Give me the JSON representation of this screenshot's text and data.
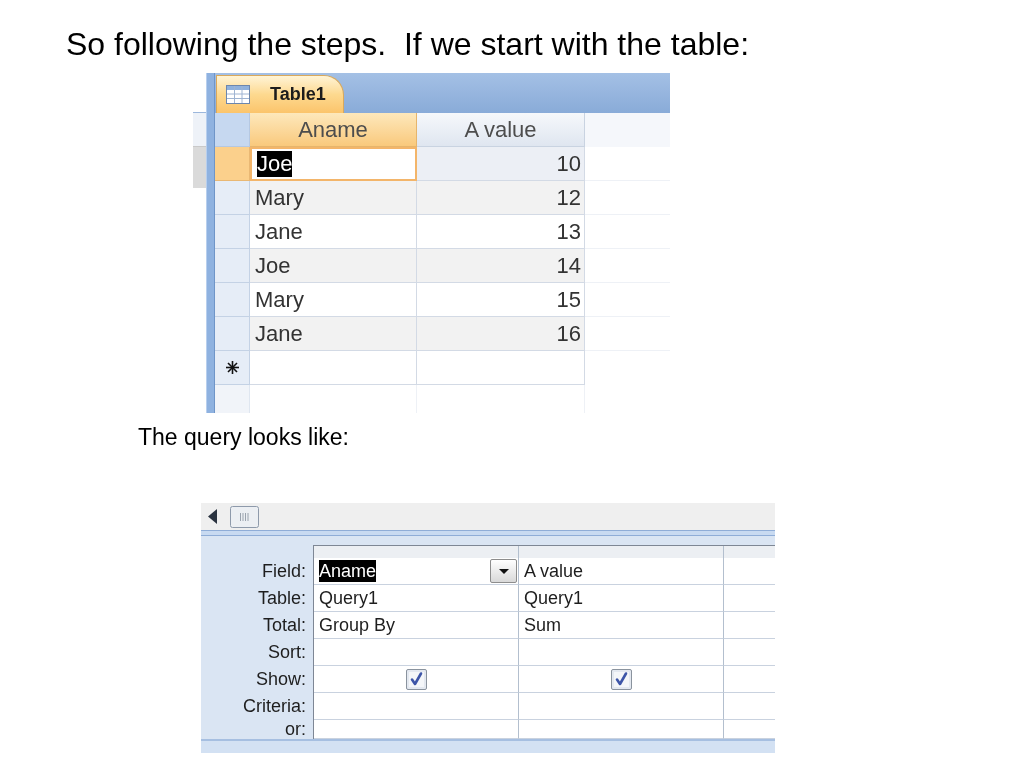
{
  "heading": "So following the steps.  If we start with the table:",
  "table_window": {
    "tab": {
      "label": "Table1",
      "selected": true
    },
    "columns": [
      {
        "label": "Aname",
        "kind": "text",
        "selected": true
      },
      {
        "label": "A value",
        "kind": "number",
        "selected": false
      }
    ],
    "rows": [
      {
        "selected": true,
        "cells": [
          "Joe",
          "10"
        ]
      },
      {
        "selected": false,
        "cells": [
          "Mary",
          "12"
        ]
      },
      {
        "selected": false,
        "cells": [
          "Jane",
          "13"
        ]
      },
      {
        "selected": false,
        "cells": [
          "Joe",
          "14"
        ]
      },
      {
        "selected": false,
        "cells": [
          "Mary",
          "15"
        ]
      },
      {
        "selected": false,
        "cells": [
          "Jane",
          "16"
        ]
      }
    ]
  },
  "caption": "The query looks like:",
  "query_grid": {
    "rows": [
      {
        "label": "Field:",
        "kind": "text",
        "cells": [
          {
            "text": "Aname",
            "selected": true
          },
          {
            "text": "A value",
            "selected": false
          }
        ]
      },
      {
        "label": "Table:",
        "kind": "text",
        "cells": [
          {
            "text": "Query1",
            "selected": false
          },
          {
            "text": "Query1",
            "selected": false
          }
        ]
      },
      {
        "label": "Total:",
        "kind": "text",
        "cells": [
          {
            "text": "Group By",
            "selected": false
          },
          {
            "text": "Sum",
            "selected": false
          }
        ]
      },
      {
        "label": "Sort:",
        "kind": "text"
      },
      {
        "label": "Show:",
        "kind": "checkbox",
        "cells": [
          {
            "checked": true
          },
          {
            "checked": true
          }
        ]
      },
      {
        "label": "Criteria:",
        "kind": "text"
      },
      {
        "label": "or:",
        "kind": "text"
      }
    ]
  }
}
